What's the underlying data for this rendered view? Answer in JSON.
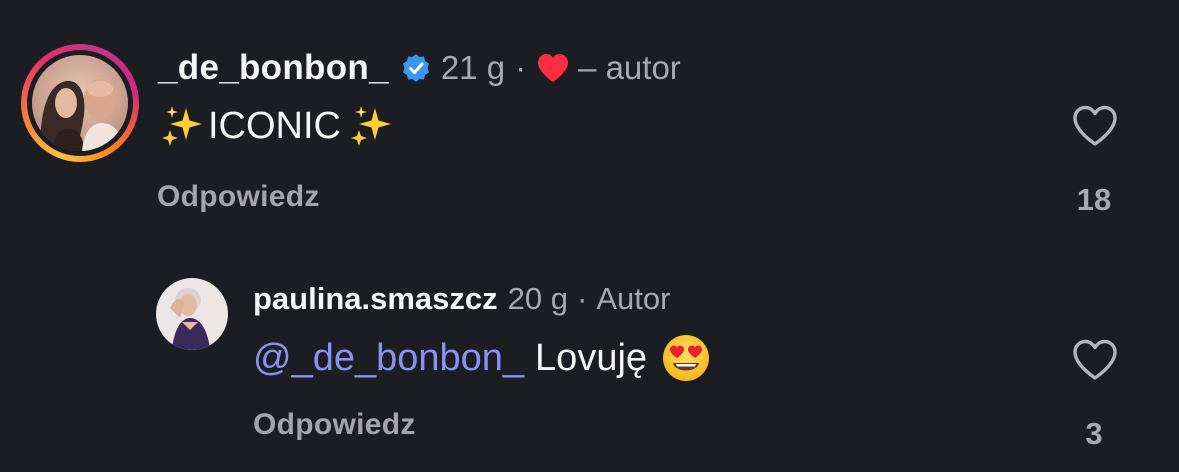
{
  "comments": [
    {
      "username": "_de_bonbon_",
      "verified": true,
      "time": "21 g",
      "separator": "·",
      "author_tag": "– autor",
      "text": "ICONIC",
      "reply_label": "Odpowiedz",
      "like_count": "18",
      "icons": [
        "story-ring-avatar",
        "verified-badge-icon",
        "red-heart-icon",
        "sparkles-icon",
        "like-heart-icon"
      ]
    },
    {
      "username": "paulina.smaszcz",
      "time": "20 g",
      "separator": "·",
      "author_tag": "Autor",
      "mention": "@_de_bonbon_",
      "text": "Lovuję",
      "reply_label": "Odpowiedz",
      "like_count": "3",
      "icons": [
        "avatar",
        "heart-eyes-emoji",
        "like-heart-icon"
      ]
    }
  ],
  "colors": {
    "background": "#1c1d23",
    "primary_text": "#f5f5f5",
    "secondary_text": "#a8a8ad",
    "mention": "#8b90f2",
    "verified_blue": "#3897f0",
    "heart_red": "#ff2d3f"
  }
}
